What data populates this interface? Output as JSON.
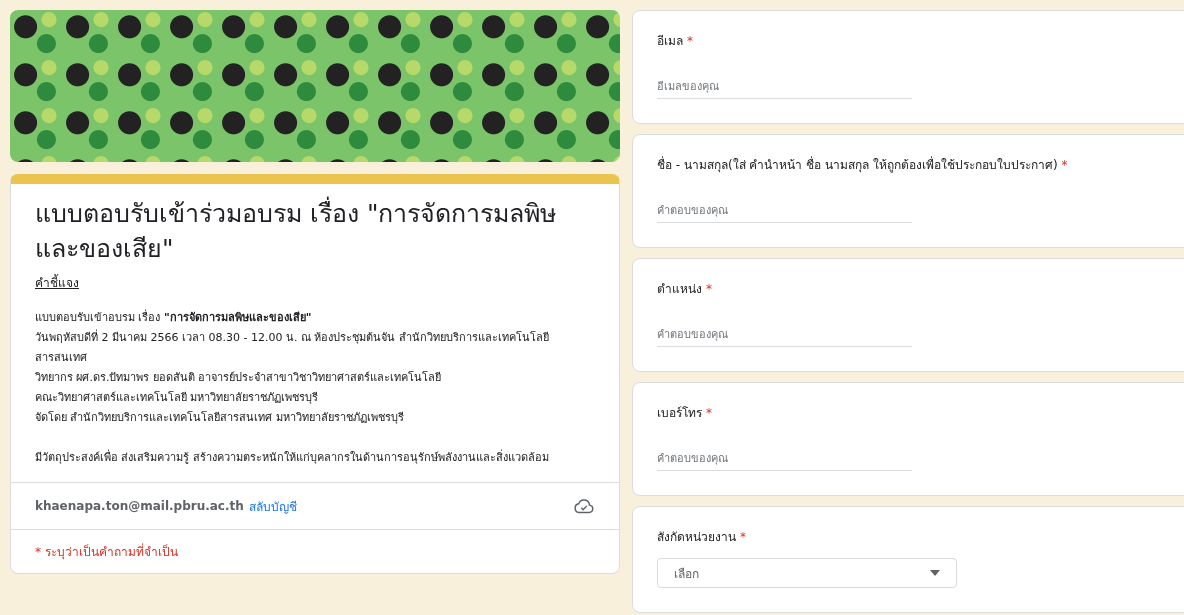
{
  "form": {
    "title": "แบบตอบรับเข้าร่วมอบรม เรื่อง \"การจัดการมลพิษและของเสีย\"",
    "description_heading": "คำชี้แจง",
    "required_mark": "*",
    "description_paragraphs": [
      [
        "แบบตอบรับเข้าอบรม เรื่อง **\"การจัดการมลพิษและของเสีย\"**",
        "วันพฤหัสบดีที่ 2 มีนาคม 2566 เวลา 08.30 - 12.00 น. ณ ห้องประชุมต้นจัน สำนักวิทยบริการและเทคโนโลยีสารสนเทศ",
        "วิทยากร ผศ.ดร.ปัทมาพร ยอดสันติ อาจารย์ประจำสาขาวิชาวิทยาศาสตร์และเทคโนโลยี",
        "คณะวิทยาศาสตร์และเทคโนโลยี มหาวิทยาลัยราชภัฏเพชรบุรี",
        "จัดโดย สำนักวิทยบริการและเทคโนโลยีสารสนเทศ มหาวิทยาลัยราชภัฏเพชรบุรี"
      ],
      [
        "มีวัตถุประสงค์เพื่อ ส่งเสริมความรู้ สร้างความตระหนักให้แก่บุคลากรในด้านการอนุรักษ์พลังงานและสิ่งแวดล้อม"
      ]
    ],
    "account": {
      "email": "khaenapa.ton@mail.pbru.ac.th",
      "switch_link": "สลับบัญชี"
    },
    "required_note": "* ระบุว่าเป็นคำถามที่จำเป็น"
  },
  "questions": [
    {
      "kind": "text",
      "label": "อีเมล",
      "required": true,
      "placeholder": "อีเมลของคุณ"
    },
    {
      "kind": "text",
      "label": "ชื่อ - นามสกุล(ใส่ คำนำหน้า ชื่อ นามสกุล ให้ถูกต้องเพื่อใช้ประกอบใบประกาศ)",
      "required": true,
      "placeholder": "คำตอบของคุณ"
    },
    {
      "kind": "text",
      "label": "ตำแหน่ง",
      "required": true,
      "placeholder": "คำตอบของคุณ"
    },
    {
      "kind": "text",
      "label": "เบอร์โทร",
      "required": true,
      "placeholder": "คำตอบของคุณ"
    },
    {
      "kind": "dropdown",
      "label": "สังกัดหน่วยงาน",
      "required": true,
      "placeholder": "เลือก"
    }
  ]
}
